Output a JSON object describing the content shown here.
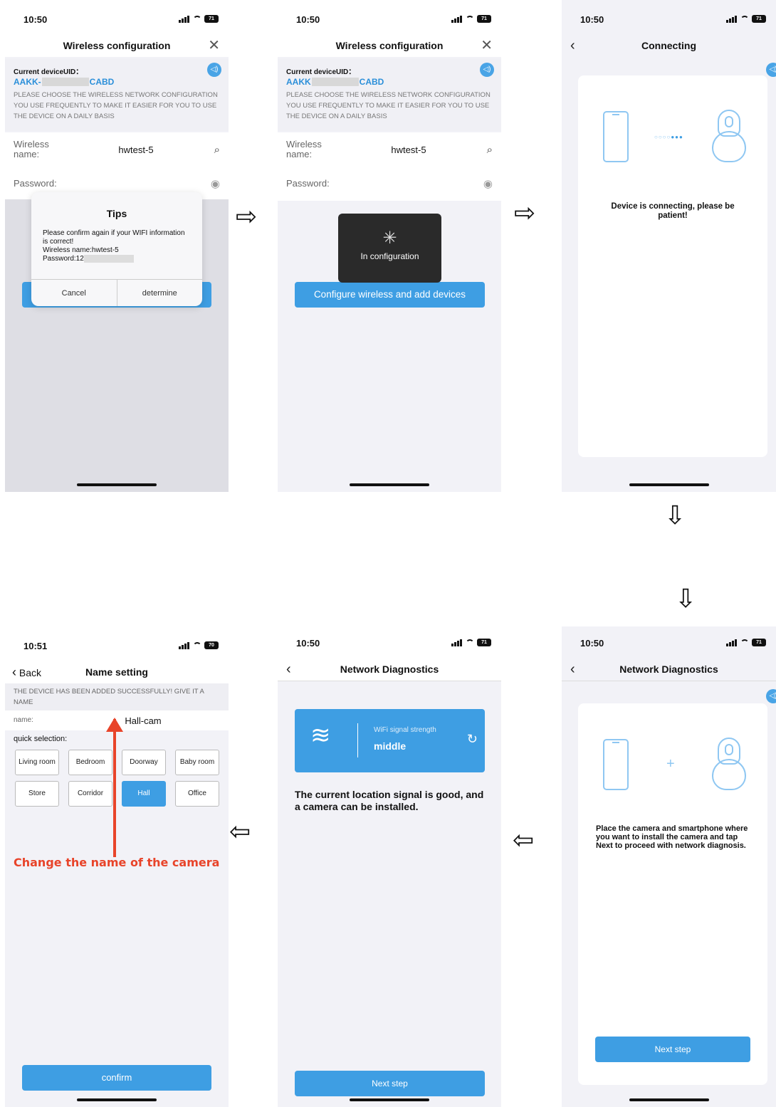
{
  "colors": {
    "accent": "#3e9ee3",
    "uid": "#2b8fd9",
    "annotation": "#e8442a"
  },
  "screen1": {
    "time": "10:50",
    "battery": "71",
    "title": "Wireless configuration",
    "uid_label": "Current deviceUID：",
    "uid_prefix": "AAKK-",
    "uid_suffix": "CABD",
    "hint": "PLEASE CHOOSE THE WIRELESS NETWORK CONFIGURATION YOU USE FREQUENTLY TO MAKE IT EASIER FOR YOU TO USE THE DEVICE ON A DAILY BASIS",
    "wireless_label": "Wireless name:",
    "wireless_value": "hwtest-5",
    "password_label": "Password:",
    "dialog": {
      "title": "Tips",
      "line1": "Please confirm again if your WIFI information is correct!",
      "line2": "Wireless name:hwtest-5",
      "line3": "Password:12",
      "cancel": "Cancel",
      "confirm": "determine"
    }
  },
  "screen2": {
    "time": "10:50",
    "battery": "71",
    "title": "Wireless configuration",
    "uid_label": "Current deviceUID：",
    "uid_prefix": "AAKK",
    "uid_suffix": "CABD",
    "hint": "PLEASE CHOOSE THE WIRELESS NETWORK CONFIGURATION YOU USE FREQUENTLY TO MAKE IT EASIER FOR YOU TO USE THE DEVICE ON A DAILY BASIS",
    "wireless_label": "Wireless name:",
    "wireless_value": "hwtest-5",
    "password_label": "Password:",
    "toast": "In configuration",
    "button": "Configure wireless and add devices"
  },
  "screen3": {
    "time": "10:50",
    "battery": "71",
    "title": "Connecting",
    "message": "Device is connecting, please be patient!"
  },
  "screen4": {
    "time": "10:51",
    "battery": "70",
    "back": "Back",
    "title": "Name setting",
    "hint": "THE DEVICE HAS BEEN ADDED SUCCESSFULLY! GIVE IT A NAME",
    "name_label": "name:",
    "name_value": "Hall-cam",
    "quick_label": "quick selection:",
    "options": [
      "Living room",
      "Bedroom",
      "Doorway",
      "Baby room",
      "Store",
      "Corridor",
      "Hall",
      "Office"
    ],
    "selected": "Hall",
    "annotation": "Change the name of the camera",
    "confirm": "confirm"
  },
  "screen5": {
    "time": "10:50",
    "battery": "71",
    "title": "Network Diagnostics",
    "signal_label": "WiFi signal strength",
    "signal_value": "middle",
    "message": "The current location signal is good, and a camera can be installed.",
    "button": "Next step"
  },
  "screen6": {
    "time": "10:50",
    "battery": "71",
    "title": "Network Diagnostics",
    "message": "Place the camera and smartphone where you want to install the camera and tap Next to proceed with network diagnosis.",
    "button": "Next step"
  }
}
